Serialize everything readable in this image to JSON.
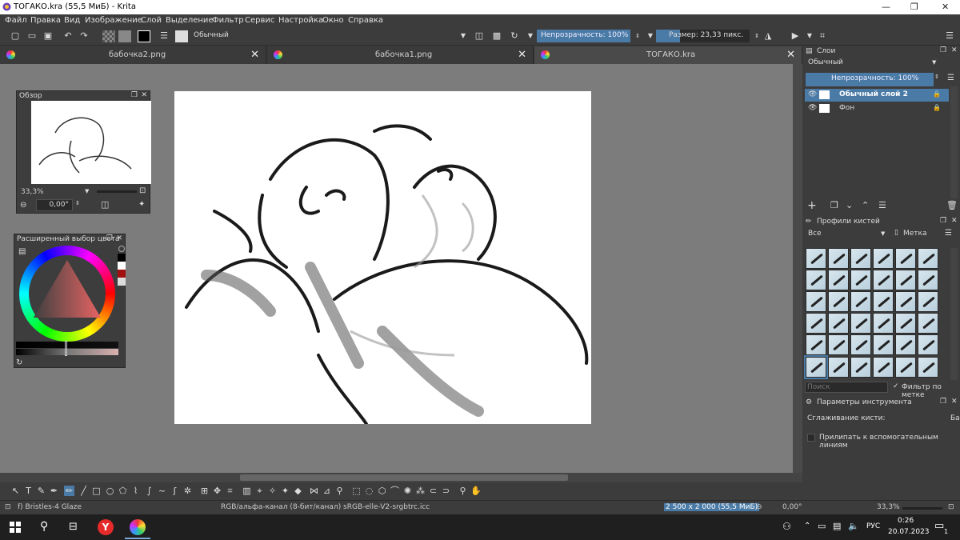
{
  "window": {
    "title": "ТОГАКО.kra (55,5 МиБ)  - Krita"
  },
  "menu": [
    "Файл",
    "Правка",
    "Вид",
    "Изображение",
    "Слой",
    "Выделение",
    "Фильтр",
    "Сервис",
    "Настройка",
    "Окно",
    "Справка"
  ],
  "toolbar": {
    "blend_mode": "Обычный",
    "opacity": "Непрозрачность: 100%",
    "size": "Размер: 23,33 пикс."
  },
  "tabs": [
    {
      "label": "бабочка2.png"
    },
    {
      "label": "бабочка1.png"
    },
    {
      "label": "ТОГАКО.kra"
    }
  ],
  "overview": {
    "title": "Обзор",
    "zoom": "33,3%",
    "rotation": "0,00°"
  },
  "color_selector": {
    "title": "Расширенный выбор цвета"
  },
  "layers": {
    "title": "Слои",
    "blend_mode": "Обычный",
    "opacity": "Непрозрачность:  100%",
    "items": [
      {
        "name": "Обычный слой 2",
        "selected": true
      },
      {
        "name": "Фон",
        "selected": false
      }
    ]
  },
  "brush_presets": {
    "title": "Профили кистей",
    "filter": "Все",
    "tag": "Метка",
    "search_placeholder": "Поиск",
    "filter_by_tag": "Фильтр по метке"
  },
  "tool_options": {
    "title": "Параметры инструмента",
    "smoothing": "Сглаживание кисти:",
    "smoothing_value": "Ба",
    "snap": "Прилипать к вспомогательным линиям"
  },
  "status": {
    "brush": "f) Bristles-4 Glaze",
    "color_space": "RGB/альфа-канал (8-бит/канал)  sRGB-elle-V2-srgbtrc.icc",
    "dims": "2 500 x 2 000 (55,5 МиБ)",
    "rotation": "0,00°",
    "zoom": "33,3%"
  },
  "taskbar": {
    "lang": "РУС",
    "time": "0:26",
    "date": "20.07.2023",
    "notif": "1"
  },
  "colors": {
    "accent": "#4a7aa6",
    "bg": "#3c3c3c",
    "canvas": "#7c7c7c"
  }
}
